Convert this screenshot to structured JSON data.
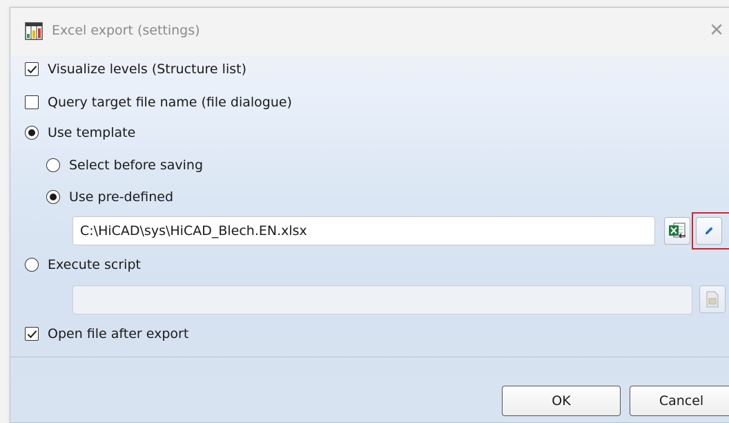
{
  "dialog": {
    "title": "Excel export (settings)",
    "close_symbol": "✕",
    "app_icon": "excel-export-icon"
  },
  "options": {
    "visualize_levels": {
      "label": "Visualize levels (Structure list)",
      "checked": true
    },
    "query_target": {
      "label": "Query target file name (file dialogue)",
      "checked": false
    },
    "use_template": {
      "label": "Use template",
      "selected": true
    },
    "select_before_saving": {
      "label": "Select before saving",
      "selected": false
    },
    "use_predefined": {
      "label": "Use pre-defined",
      "selected": true
    },
    "template_path": "C:\\HiCAD\\sys\\HiCAD_Blech.EN.xlsx",
    "execute_script": {
      "label": "Execute script",
      "selected": false
    },
    "script_path": "",
    "open_after_export": {
      "label": "Open file after export",
      "checked": true
    }
  },
  "buttons": {
    "ok": "OK",
    "cancel": "Cancel"
  },
  "icons": {
    "excel": "excel-file-icon",
    "edit": "pencil-edit-icon",
    "script": "script-file-icon",
    "check": "checkmark-icon"
  },
  "colors": {
    "highlight": "#d6202a",
    "excel_green": "#1d7a3e",
    "pencil_blue": "#1f6fd1"
  }
}
